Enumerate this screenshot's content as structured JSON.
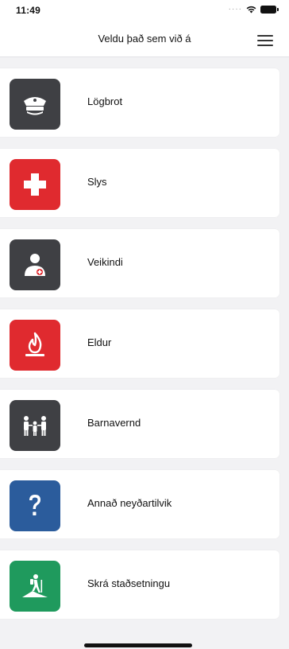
{
  "status_bar": {
    "time": "11:49"
  },
  "header": {
    "title": "Veldu það sem við á"
  },
  "items": [
    {
      "label": "Lögbrot",
      "icon": "police-cap-icon",
      "color": "#3f4044"
    },
    {
      "label": "Slys",
      "icon": "first-aid-cross-icon",
      "color": "#e02a2f"
    },
    {
      "label": "Veikindi",
      "icon": "sick-person-icon",
      "color": "#3f4044"
    },
    {
      "label": "Eldur",
      "icon": "fire-icon",
      "color": "#e02a2f"
    },
    {
      "label": "Barnavernd",
      "icon": "family-icon",
      "color": "#3f4044"
    },
    {
      "label": "Annað neyðartilvik",
      "icon": "question-mark-icon",
      "color": "#2b5c9c"
    },
    {
      "label": "Skrá staðsetningu",
      "icon": "hiker-icon",
      "color": "#1f9a5d"
    }
  ]
}
